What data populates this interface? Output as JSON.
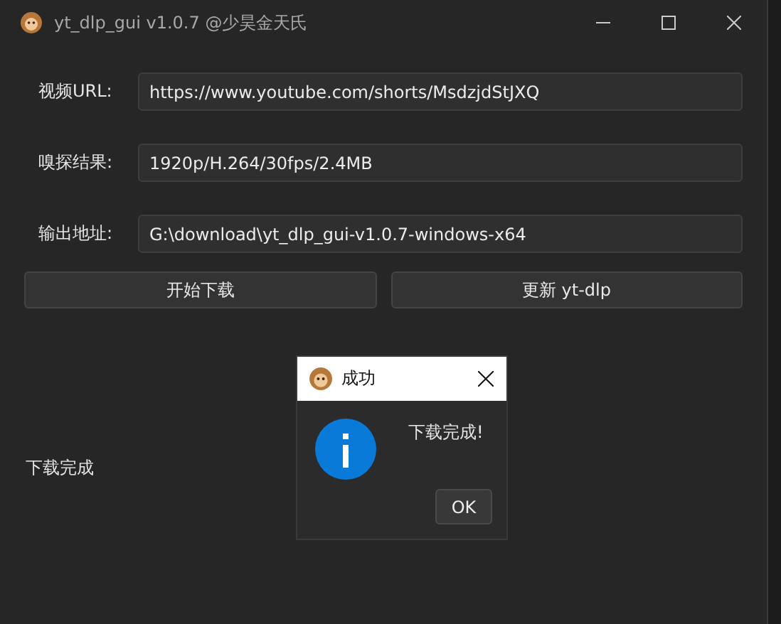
{
  "window": {
    "title": "yt_dlp_gui v1.0.7 @少昊金天氏"
  },
  "fields": [
    {
      "label": "视频URL:",
      "value": "https://www.youtube.com/shorts/MsdzjdStJXQ"
    },
    {
      "label": "嗅探结果:",
      "value": "1920p/H.264/30fps/2.4MB"
    },
    {
      "label": "输出地址:",
      "value": "G:\\download\\yt_dlp_gui-v1.0.7-windows-x64"
    }
  ],
  "buttons": [
    "开始下载",
    "更新 yt-dlp"
  ],
  "status": "下载完成",
  "dialog": {
    "title": "成功",
    "message": "下载完成!",
    "button": "OK"
  }
}
